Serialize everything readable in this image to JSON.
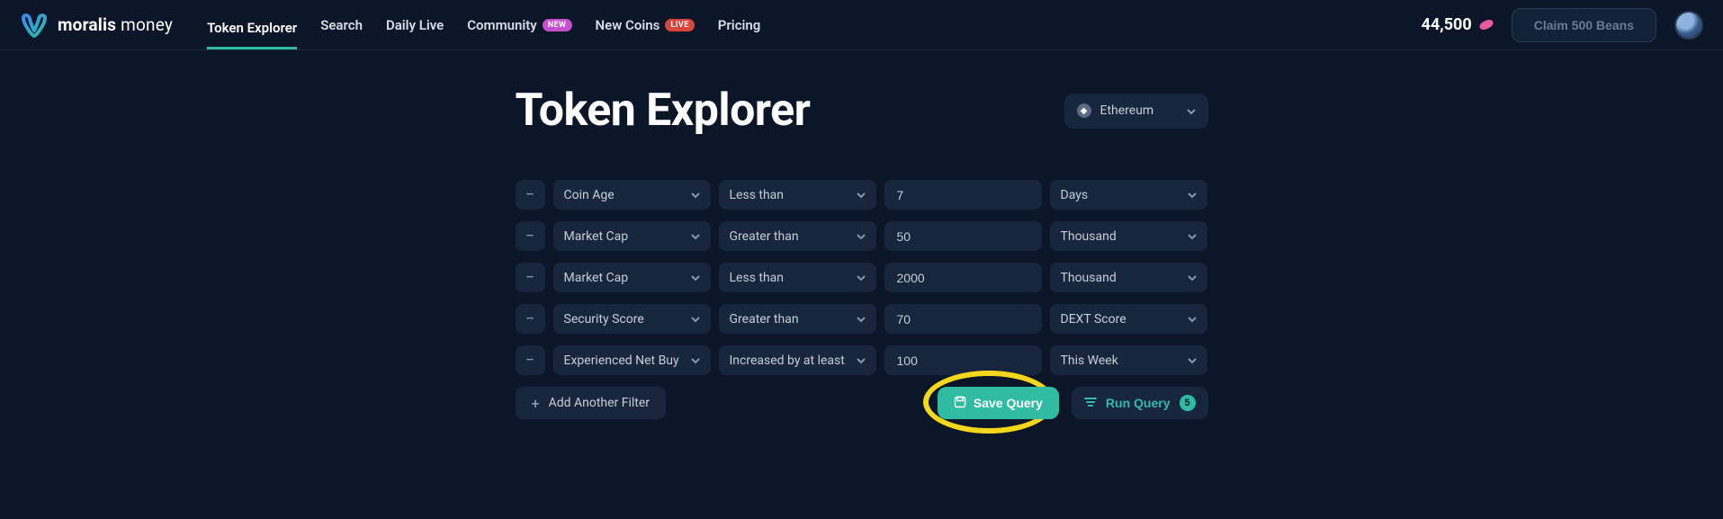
{
  "brand": {
    "name_bold": "moralis",
    "name_light": "money"
  },
  "nav": {
    "token_explorer": "Token Explorer",
    "search": "Search",
    "daily_live": "Daily Live",
    "community": "Community",
    "community_badge": "NEW",
    "new_coins": "New Coins",
    "new_coins_badge": "LIVE",
    "pricing": "Pricing"
  },
  "topbar": {
    "bean_count": "44,500",
    "claim_label": "Claim 500 Beans"
  },
  "page": {
    "title": "Token Explorer",
    "chain": "Ethereum"
  },
  "filters": [
    {
      "metric": "Coin Age",
      "comparator": "Less than",
      "value": "7",
      "unit": "Days"
    },
    {
      "metric": "Market Cap",
      "comparator": "Greater than",
      "value": "50",
      "unit": "Thousand"
    },
    {
      "metric": "Market Cap",
      "comparator": "Less than",
      "value": "2000",
      "unit": "Thousand"
    },
    {
      "metric": "Security Score",
      "comparator": "Greater than",
      "value": "70",
      "unit": "DEXT Score"
    },
    {
      "metric": "Experienced Net Buy",
      "comparator": "Increased by at least",
      "value": "100",
      "unit": "This Week"
    }
  ],
  "actions": {
    "add_filter": "Add Another Filter",
    "save_query": "Save Query",
    "run_query": "Run Query",
    "run_count": "5"
  }
}
